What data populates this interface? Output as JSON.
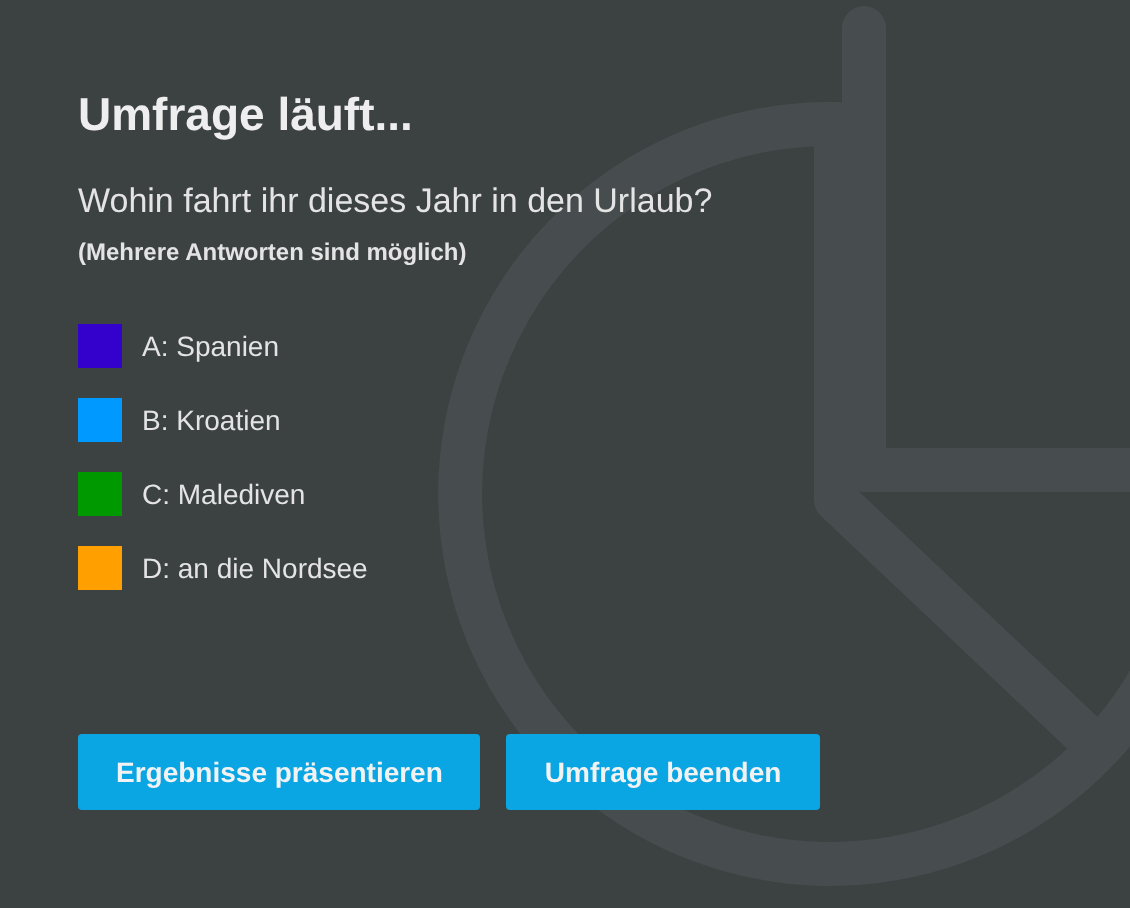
{
  "title": "Umfrage läuft...",
  "question": "Wohin fahrt ihr dieses Jahr in den Urlaub?",
  "note": "(Mehrere Antworten sind möglich)",
  "answers": [
    {
      "label": "A: Spanien",
      "color": "#3300cc"
    },
    {
      "label": "B: Kroatien",
      "color": "#0099ff"
    },
    {
      "label": "C: Malediven",
      "color": "#009900"
    },
    {
      "label": "D: an die Nordsee",
      "color": "#ffa000"
    }
  ],
  "buttons": [
    "Ergebnisse präsentieren",
    "Umfrage beenden"
  ]
}
